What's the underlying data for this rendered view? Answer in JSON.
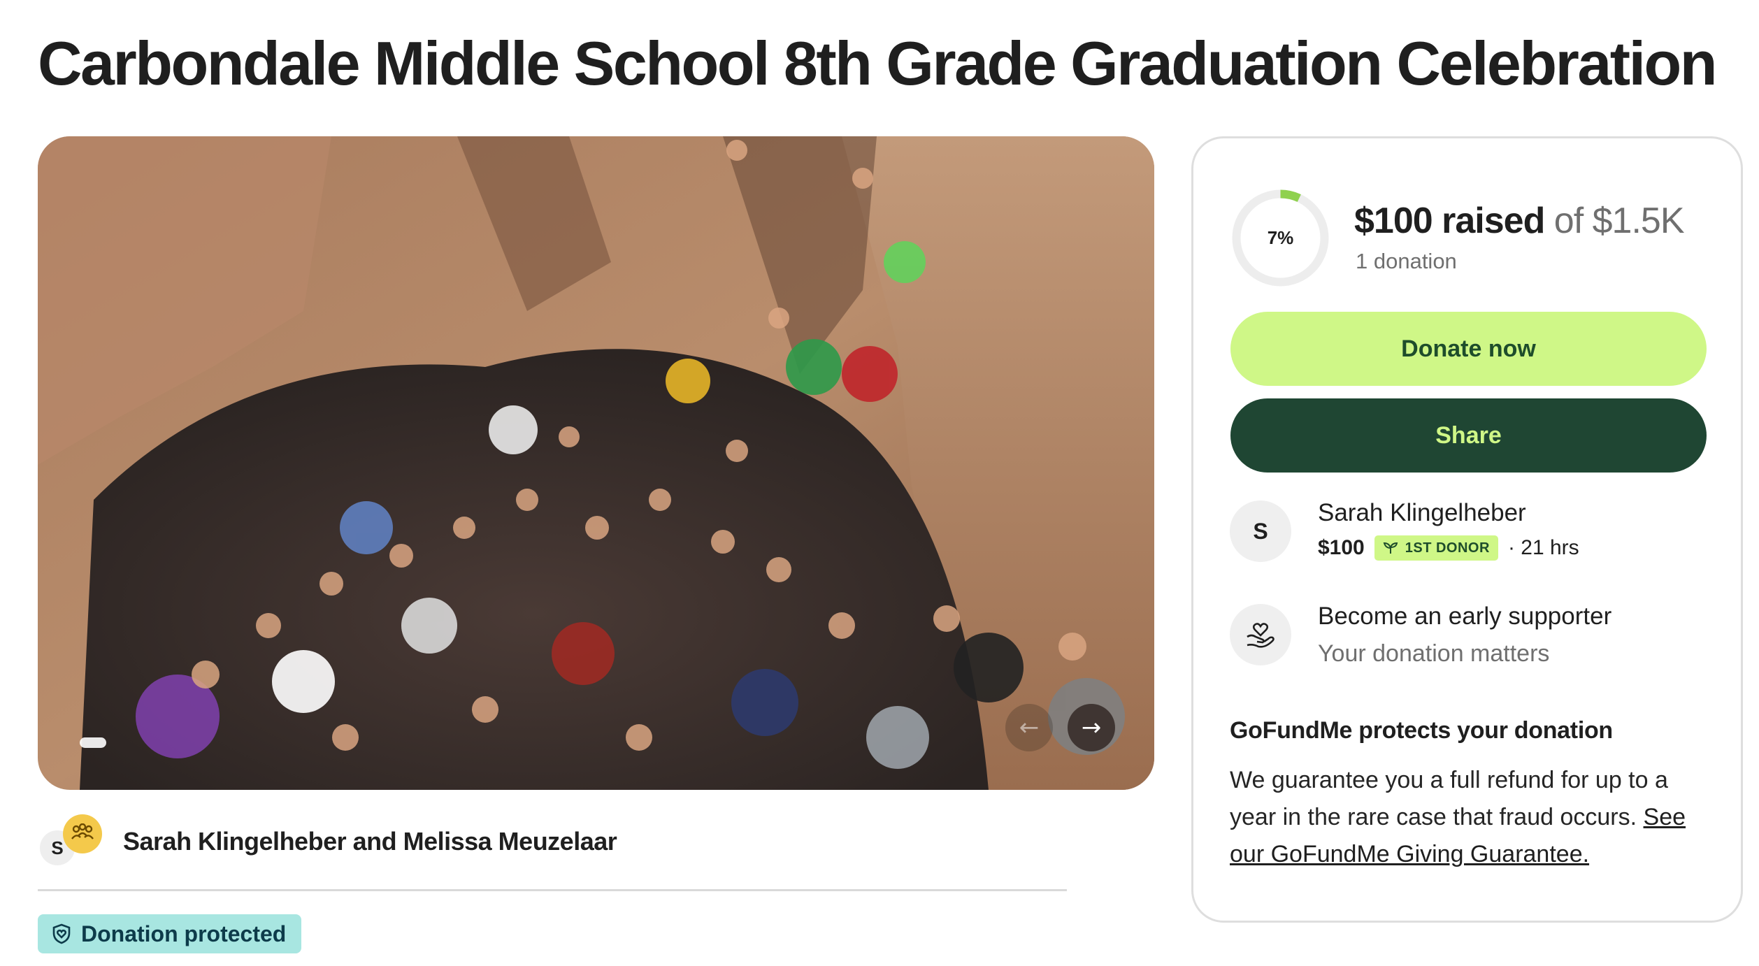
{
  "campaign": {
    "title": "Carbondale Middle School 8th Grade Graduation Celebration"
  },
  "gallery": {
    "prev_icon": "arrow-left-icon",
    "next_icon": "arrow-right-icon"
  },
  "organizers": {
    "initial": "S",
    "names": "Sarah Klingelheber and Melissa Meuzelaar",
    "group_icon": "team-icon"
  },
  "protection_badge": {
    "label": "Donation protected",
    "icon": "shield-heart-icon"
  },
  "progress": {
    "percent": 7,
    "percent_label": "7%",
    "raised": "$100 raised",
    "goal": "of $1.5K",
    "donation_count": "1 donation",
    "ring_color": "#8fd14f"
  },
  "actions": {
    "donate_label": "Donate now",
    "share_label": "Share"
  },
  "recent_donor": {
    "initial": "S",
    "name": "Sarah Klingelheber",
    "amount": "$100",
    "tag": "1ST DONOR",
    "time": "· 21 hrs"
  },
  "early_supporter": {
    "title": "Become an early supporter",
    "subtitle": "Your donation matters",
    "icon": "heart-hand-icon"
  },
  "guarantee": {
    "title": "GoFundMe protects your donation",
    "body": "We guarantee you a full refund for up to a year in the rare case that fraud occurs.",
    "link": "See our GoFundMe Giving Guarantee."
  },
  "colors": {
    "brand_green": "#cff787",
    "dark_green": "#1f4633",
    "badge_teal": "#a8e6e1"
  }
}
